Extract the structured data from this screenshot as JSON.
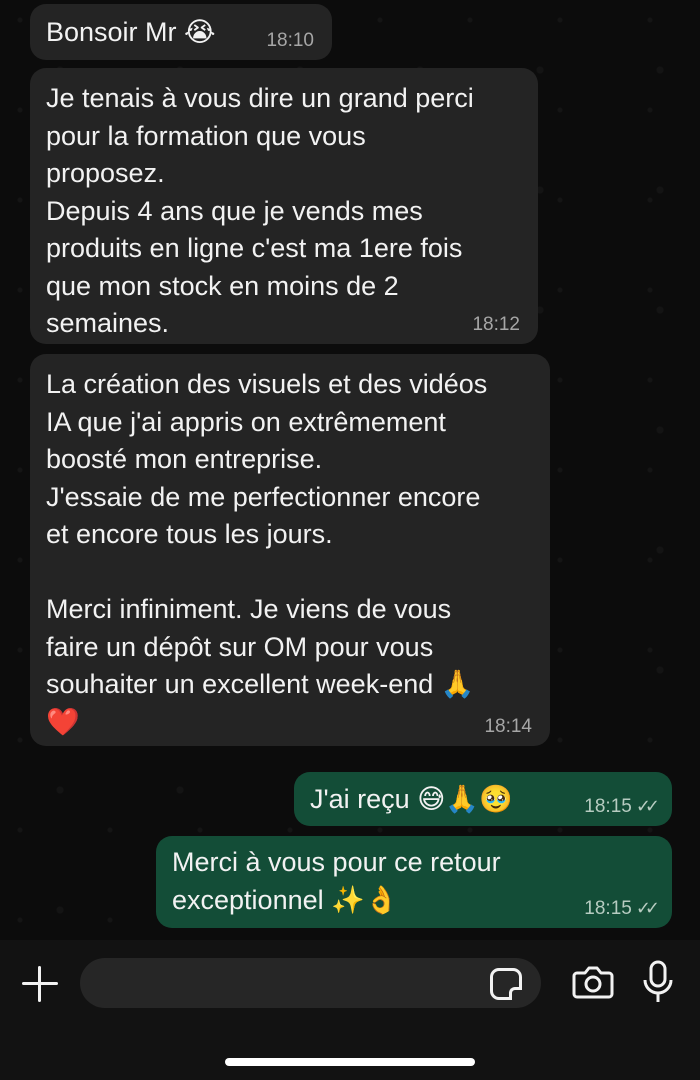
{
  "messages": [
    {
      "dir": "in",
      "text": "Bonsoir Mr 😭",
      "time": "18:10"
    },
    {
      "dir": "in",
      "text": "Je tenais à vous dire un grand perci\npour la formation que vous\nproposez.\nDepuis 4 ans que je vends mes\nproduits en ligne c'est ma 1ere fois\nque mon stock en moins de 2\nsemaines.",
      "time": "18:12"
    },
    {
      "dir": "in",
      "text": "La création des visuels et des vidéos\nIA que j'ai appris on extrêmement\nboosté mon entreprise.\nJ'essaie de me perfectionner encore\net encore tous les jours.\n\nMerci infiniment. Je viens de vous\nfaire un dépôt sur OM pour vous\nsouhaiter un excellent week-end 🙏\n❤️",
      "time": "18:14"
    },
    {
      "dir": "out",
      "text": "J'ai reçu 😅🙏🥹",
      "time": "18:15",
      "status": "read"
    },
    {
      "dir": "out",
      "text": "Merci à vous pour ce retour\nexceptionnel ✨👌",
      "time": "18:15",
      "status": "read"
    }
  ],
  "composer": {
    "value": ""
  },
  "icons": [
    "plus-icon",
    "sticker-icon",
    "camera-icon",
    "microphone-icon",
    "double-check-icon"
  ],
  "colors": {
    "incoming_bubble": "#242424",
    "outgoing_bubble": "#134d37",
    "background": "#0c0c0c"
  }
}
